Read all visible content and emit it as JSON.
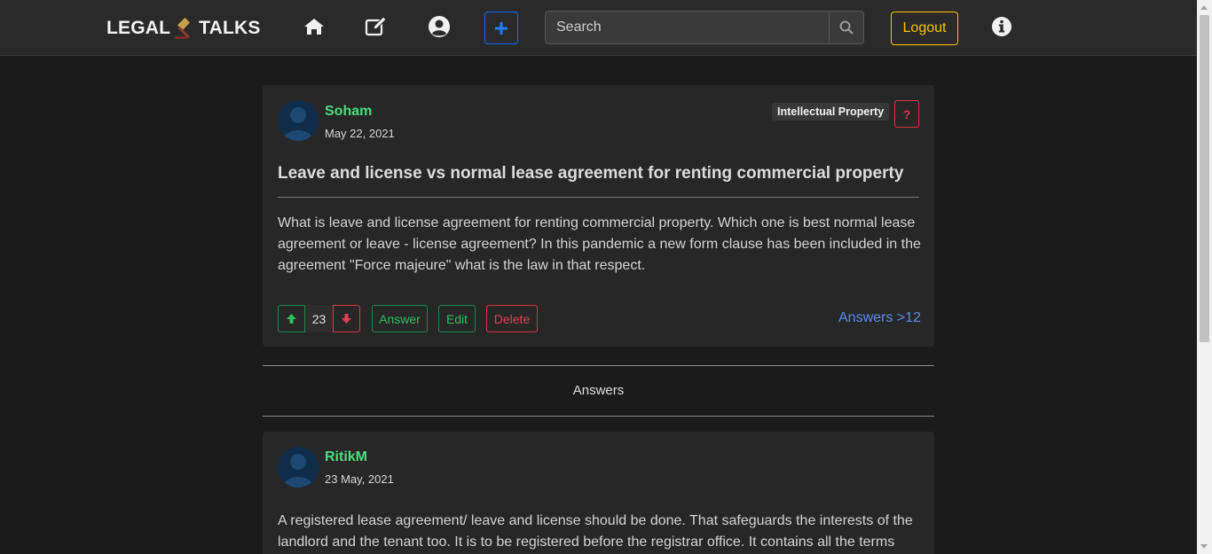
{
  "navbar": {
    "brand_left": "LEGAL",
    "brand_right": "TALKS",
    "search_placeholder": "Search",
    "logout_label": "Logout",
    "icons": [
      "home-icon",
      "edit-icon",
      "user-circle-icon",
      "plus-icon",
      "search-icon",
      "info-icon"
    ]
  },
  "question": {
    "author": "Soham",
    "date": "May 22, 2021",
    "tag": "Intellectual Property",
    "type_badge": "?",
    "title": "Leave and license vs normal lease agreement for renting commercial property",
    "body": "What is leave and license agreement for renting commercial property. Which one is best normal lease agreement or leave - license agreement? In this pandemic a new form clause has been included in the agreement \"Force majeure\" what is the law in that respect.",
    "votes": "23",
    "answer_label": "Answer",
    "edit_label": "Edit",
    "delete_label": "Delete",
    "answers_link": "Answers >12"
  },
  "answers_section": {
    "heading": "Answers"
  },
  "answer": {
    "author": "RitikM",
    "date": "23 May, 2021",
    "body": "A registered lease agreement/ leave and license should be done. That safeguards the interests of the landlord and the tenant too. It is to be registered before the registrar office. It contains all the terms"
  },
  "colors": {
    "background": "#1b1b1b",
    "navbar": "#2a2a2a",
    "card": "#272727",
    "author": "#4ade80",
    "primary": "#0d6efd",
    "warning": "#ffc107",
    "success": "#198754",
    "danger": "#dc3545",
    "link": "#5b8def"
  }
}
